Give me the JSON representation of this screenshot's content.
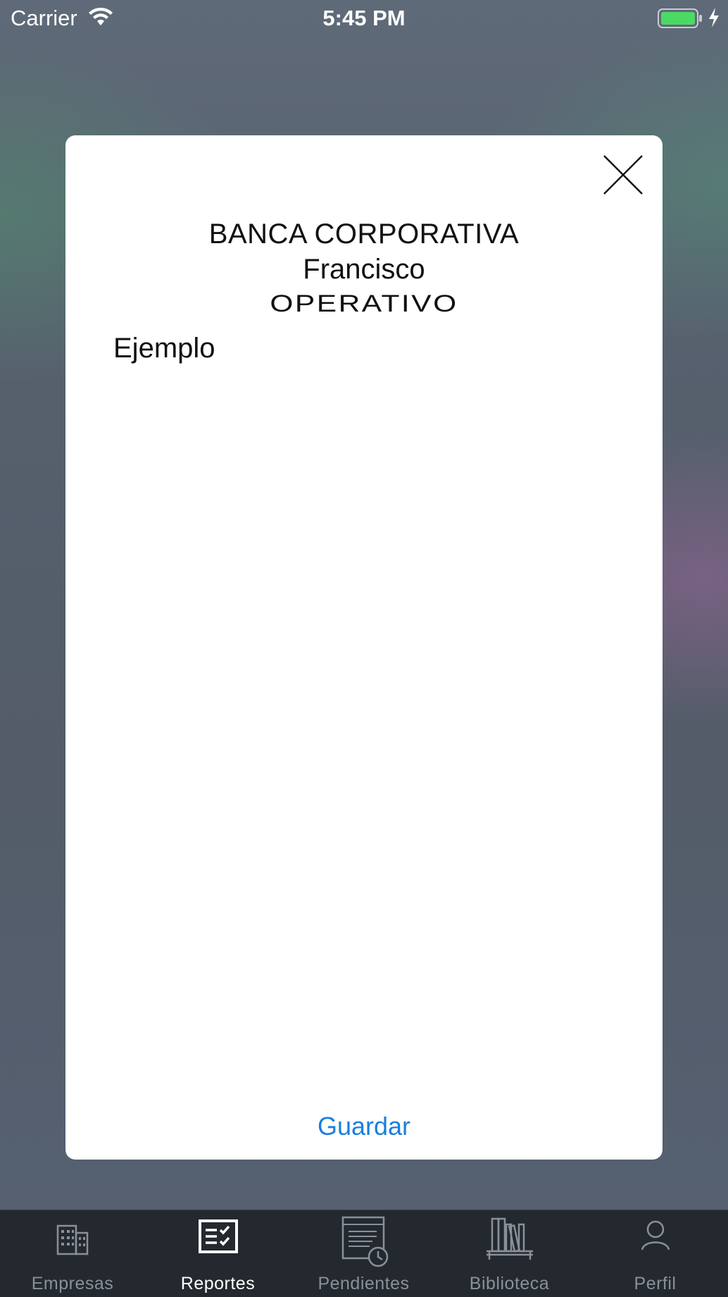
{
  "status_bar": {
    "carrier": "Carrier",
    "time": "5:45 PM",
    "wifi_icon": "wifi-icon",
    "battery_icon": "battery-charging-icon"
  },
  "modal": {
    "close_icon": "close-icon",
    "title": "BANCA CORPORATIVA",
    "subtitle": "Francisco",
    "role": "OPERATIVO",
    "text": "Ejemplo",
    "save_label": "Guardar",
    "accent_color": "#1a7fe0"
  },
  "tab_bar": {
    "active": "Reportes",
    "items": [
      {
        "label": "Empresas",
        "icon": "building-icon"
      },
      {
        "label": "Reportes",
        "icon": "report-checklist-icon"
      },
      {
        "label": "Pendientes",
        "icon": "pending-clock-icon"
      },
      {
        "label": "Biblioteca",
        "icon": "bookshelf-icon"
      },
      {
        "label": "Perfil",
        "icon": "person-icon"
      }
    ]
  }
}
